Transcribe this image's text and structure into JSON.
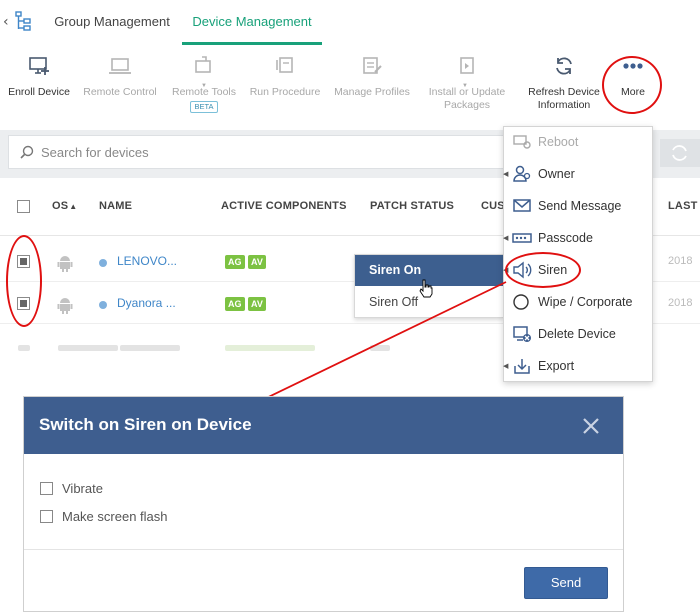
{
  "tabs": {
    "group": "Group Management",
    "device": "Device Management"
  },
  "toolbar": {
    "enroll": "Enroll Device",
    "remote_control": "Remote Control",
    "remote_tools": "Remote Tools",
    "beta": "BETA",
    "run_procedure": "Run Procedure",
    "manage_profiles": "Manage Profiles",
    "install_line1": "Install or Update",
    "install_line2": "Packages",
    "refresh_line1": "Refresh Device",
    "refresh_line2": "Information",
    "more": "More"
  },
  "search": {
    "placeholder": "Search for devices"
  },
  "table": {
    "columns": {
      "os": "OS",
      "name": "NAME",
      "active": "ACTIVE COMPONENTS",
      "patch": "PATCH STATUS",
      "cus": "CUS",
      "last": "LAST"
    },
    "rows": [
      {
        "name": "LENOVO...",
        "badges": [
          "AG",
          "AV"
        ],
        "date": "2018"
      },
      {
        "name": "Dyanora ...",
        "badges": [
          "AG",
          "AV"
        ],
        "date": "2018"
      }
    ]
  },
  "siren_menu": {
    "on": "Siren On",
    "off": "Siren Off"
  },
  "more_menu": {
    "reboot": "Reboot",
    "owner": "Owner",
    "send_message": "Send Message",
    "passcode": "Passcode",
    "siren": "Siren",
    "wipe": "Wipe / Corporate",
    "delete": "Delete Device",
    "export": "Export"
  },
  "dialog": {
    "title": "Switch on Siren on Device",
    "vibrate": "Vibrate",
    "flash": "Make screen flash",
    "send": "Send"
  },
  "colors": {
    "accent_green": "#18a17a",
    "header_blue": "#3e5e8f",
    "annotation_red": "#e01010",
    "badge_green": "#7cc242"
  }
}
